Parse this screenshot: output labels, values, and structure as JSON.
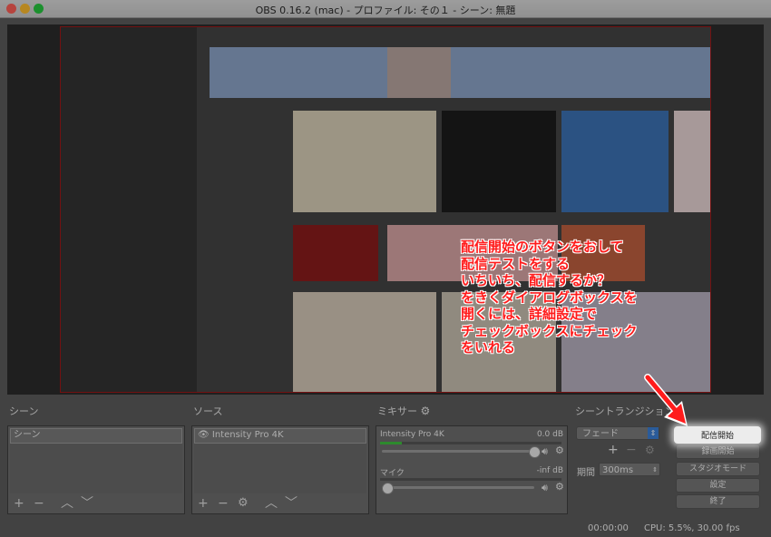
{
  "window": {
    "title": "OBS 0.16.2 (mac) - プロファイル: その１ - シーン: 無題",
    "colors": {
      "close": "#fd5f57",
      "minimize": "#febc2e",
      "zoom": "#28c840"
    }
  },
  "docks": {
    "scenes": {
      "title": "シーン",
      "items": [
        "シーン"
      ],
      "toolbar": {
        "add": "+",
        "remove": "−",
        "up": "︿",
        "down": "﹀"
      }
    },
    "sources": {
      "title": "ソース",
      "items": [
        {
          "label": "Intensity Pro 4K",
          "icon": "eye-icon"
        }
      ],
      "toolbar": {
        "add": "+",
        "remove": "−",
        "settings": "⚙",
        "up": "︿",
        "down": "﹀"
      }
    },
    "mixer": {
      "title": "ミキサー",
      "channels": [
        {
          "name": "Intensity Pro 4K",
          "level": "0.0 dB",
          "volume": 1.0,
          "meter": 0.1
        },
        {
          "name": "マイク",
          "level": "-inf dB",
          "volume": 0.0,
          "meter": 0.0
        }
      ]
    },
    "transitions": {
      "title": "シーントランジション",
      "selected": "フェード",
      "duration_label": "期間",
      "duration_value": "300ms",
      "toolbar": {
        "add": "+",
        "remove": "−",
        "settings": "⚙"
      }
    }
  },
  "controls": {
    "start_streaming": "配信開始",
    "start_recording": "録画開始",
    "studio_mode": "スタジオモード",
    "settings": "設定",
    "exit": "終了"
  },
  "status": {
    "time": "00:00:00",
    "cpu": "CPU: 5.5%, 30.00 fps"
  },
  "annotation": {
    "text": "配信開始のボタンをおして\n配信テストをする\nいちいち、配信するか？\nをきくダイアログボックスを\n開くには、詳細設定で\nチェックボックスにチェック\nをいれる",
    "color": "#ff1c1c"
  }
}
